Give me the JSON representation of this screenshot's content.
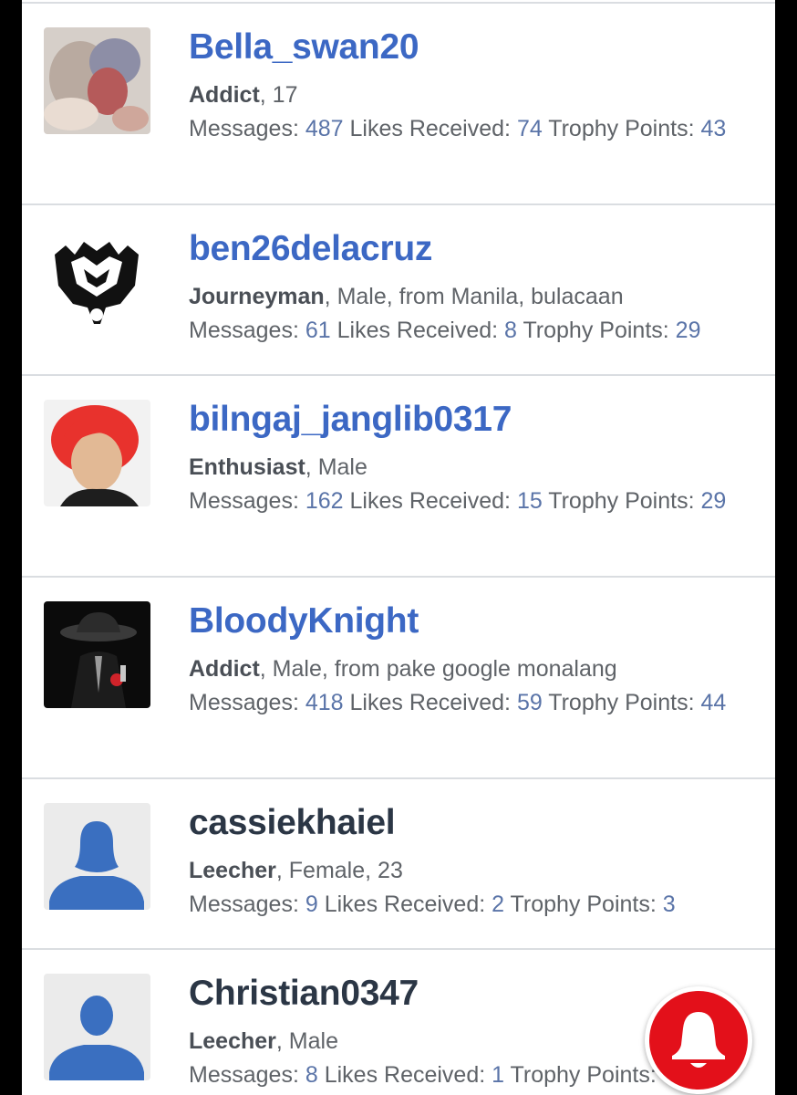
{
  "members": [
    {
      "username": "Bella_swan20",
      "avatar": "photo-avatar",
      "rank": "Addict",
      "extra": ", 17",
      "stats": {
        "messages_label": "Messages:",
        "messages": "487",
        "likes_label": "Likes Received:",
        "likes": "74",
        "trophy_label": "Trophy Points:",
        "trophy": "43"
      }
    },
    {
      "username": "ben26delacruz",
      "avatar": "logo-avatar",
      "rank": "Journeyman",
      "extra": ", Male, from Manila, bulacaan",
      "stats": {
        "messages_label": "Messages:",
        "messages": "61",
        "likes_label": "Likes Received:",
        "likes": "8",
        "trophy_label": "Trophy Points:",
        "trophy": "29"
      }
    },
    {
      "username": "bilngaj_janglib0317",
      "avatar": "photo-avatar",
      "rank": "Enthusiast",
      "extra": ", Male",
      "stats": {
        "messages_label": "Messages:",
        "messages": "162",
        "likes_label": "Likes Received:",
        "likes": "15",
        "trophy_label": "Trophy Points:",
        "trophy": "29"
      }
    },
    {
      "username": "BloodyKnight",
      "avatar": "photo-avatar",
      "rank": "Addict",
      "extra": ", Male, from pake google monalang",
      "stats": {
        "messages_label": "Messages:",
        "messages": "418",
        "likes_label": "Likes Received:",
        "likes": "59",
        "trophy_label": "Trophy Points:",
        "trophy": "44"
      }
    },
    {
      "username": "cassiekhaiel",
      "avatar": "default-female-avatar",
      "rank": "Leecher",
      "extra": ", Female, 23",
      "stats": {
        "messages_label": "Messages:",
        "messages": "9",
        "likes_label": "Likes Received:",
        "likes": "2",
        "trophy_label": "Trophy Points:",
        "trophy": "3"
      }
    },
    {
      "username": "Christian0347",
      "avatar": "default-male-avatar",
      "rank": "Leecher",
      "extra": ", Male",
      "stats": {
        "messages_label": "Messages:",
        "messages": "8",
        "likes_label": "Likes Received:",
        "likes": "1",
        "trophy_label": "Trophy Points:",
        "trophy": ""
      }
    }
  ],
  "fab": {
    "icon": "bell-icon",
    "color": "#e3101a"
  },
  "colors": {
    "username": "#3c68c4",
    "username_default": "#2b3645",
    "stat_number": "#5a74a8"
  }
}
